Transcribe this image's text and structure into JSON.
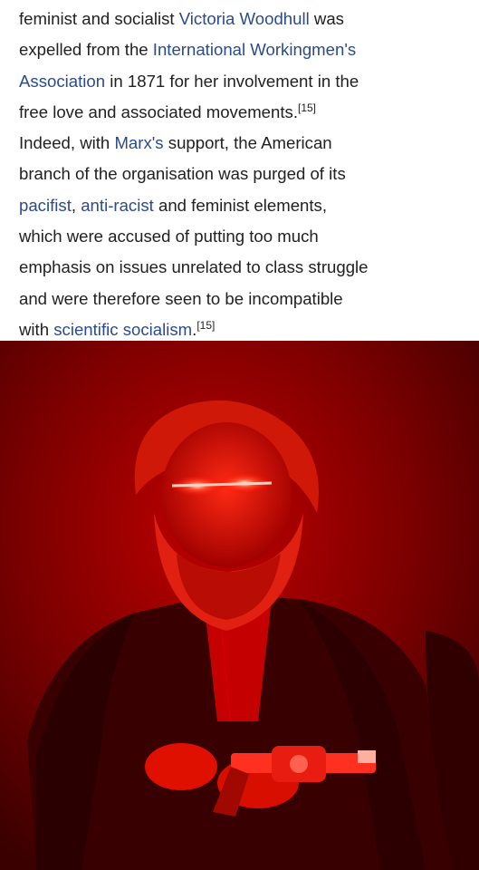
{
  "article": {
    "lines": [
      [
        {
          "t": "feminist and socialist ",
          "k": "text"
        },
        {
          "t": "Victoria Woodhull",
          "k": "link"
        },
        {
          "t": " was",
          "k": "text"
        }
      ],
      [
        {
          "t": "expelled from the ",
          "k": "text"
        },
        {
          "t": "International Workingmen's",
          "k": "link"
        }
      ],
      [
        {
          "t": "Association",
          "k": "link"
        },
        {
          "t": " in 1871 for her involvement in the",
          "k": "text"
        }
      ],
      [
        {
          "t": "free love and associated movements.",
          "k": "text"
        },
        {
          "t": "[15]",
          "k": "ref"
        }
      ],
      [
        {
          "t": "Indeed, with ",
          "k": "text"
        },
        {
          "t": "Marx's",
          "k": "link"
        },
        {
          "t": " support, the American",
          "k": "text"
        }
      ],
      [
        {
          "t": "branch of the organisation was purged of its",
          "k": "text"
        }
      ],
      [
        {
          "t": "pacifist",
          "k": "link"
        },
        {
          "t": ", ",
          "k": "text"
        },
        {
          "t": "anti-racist",
          "k": "link"
        },
        {
          "t": " and feminist elements,",
          "k": "text"
        }
      ],
      [
        {
          "t": "which were accused of putting too much",
          "k": "text"
        }
      ],
      [
        {
          "t": "emphasis on issues unrelated to class struggle",
          "k": "text"
        }
      ],
      [
        {
          "t": "and were therefore seen to be incompatible",
          "k": "text"
        }
      ],
      [
        {
          "t": "with ",
          "k": "text"
        },
        {
          "t": "scientific socialism",
          "k": "link"
        },
        {
          "t": ".",
          "k": "text"
        },
        {
          "t": "[15]",
          "k": "ref"
        }
      ]
    ]
  },
  "colors": {
    "text": "#202122",
    "link": "#2a4b8d",
    "photo_tint": "#e00000",
    "eye_glow": "#ff3a2a"
  },
  "image": {
    "description_icon": "red-tinted-portrait",
    "subject_icon": "bearded-man-with-revolver"
  }
}
